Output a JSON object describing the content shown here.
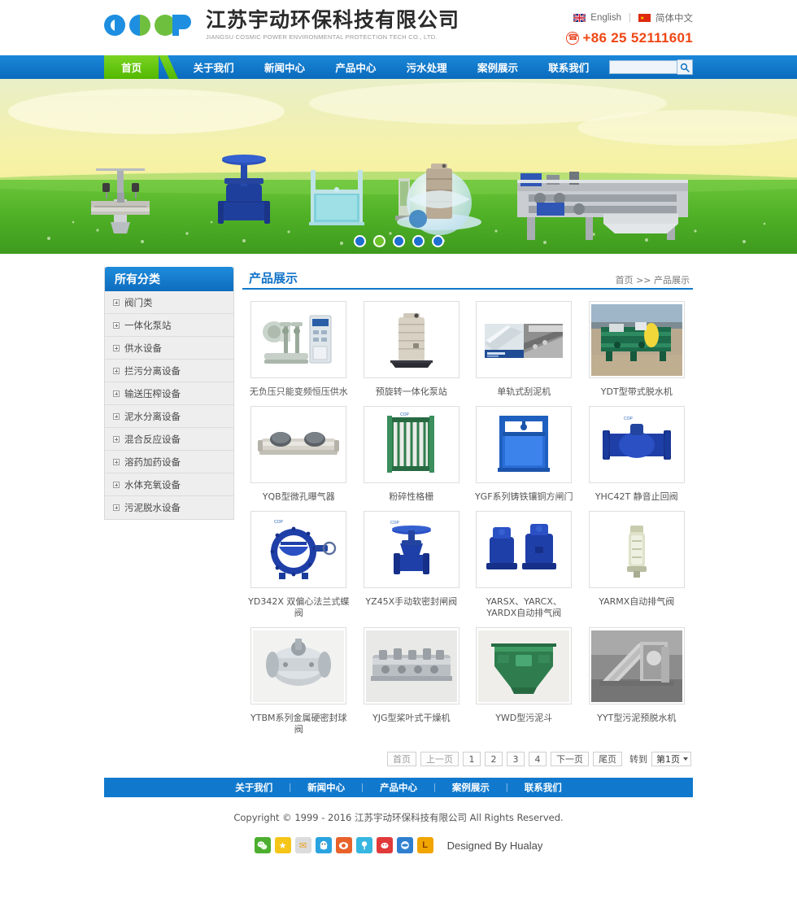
{
  "header": {
    "logo_cn": "江苏宇动环保科技有限公司",
    "logo_en": "JIANGSU COSMIC POWER ENVIRONMENTAL PROTECTION TECH CO., LTD.",
    "logo_letters": "COP",
    "lang_en": "English",
    "lang_cn": "简体中文",
    "lang_sep": "|",
    "phone": "+86 25 52111601",
    "uk_flag_icon": "uk-flag-icon",
    "cn_flag_icon": "cn-flag-icon",
    "phone_icon": "phone-icon"
  },
  "nav": {
    "home": "首页",
    "items": [
      {
        "label": "关于我们"
      },
      {
        "label": "新闻中心"
      },
      {
        "label": "产品中心"
      },
      {
        "label": "污水处理"
      },
      {
        "label": "案例展示"
      },
      {
        "label": "联系我们"
      }
    ],
    "search_value": "",
    "search_placeholder": "",
    "search_icon": "search-icon"
  },
  "banner": {
    "dots": [
      {
        "active": false
      },
      {
        "active": true
      },
      {
        "active": false
      },
      {
        "active": false
      },
      {
        "active": false
      }
    ],
    "sky_color": "#f2efa8",
    "grass_color": "#59b72a"
  },
  "sidebar": {
    "title": "所有分类",
    "items": [
      {
        "label": "阀门类"
      },
      {
        "label": "一体化泵站"
      },
      {
        "label": "供水设备"
      },
      {
        "label": "拦污分离设备"
      },
      {
        "label": "输送压榨设备"
      },
      {
        "label": "泥水分离设备"
      },
      {
        "label": "混合反应设备"
      },
      {
        "label": "溶药加药设备"
      },
      {
        "label": "水体充氧设备"
      },
      {
        "label": "污泥脱水设备"
      }
    ]
  },
  "content": {
    "title": "产品展示",
    "breadcrumb_home": "首页",
    "breadcrumb_sep": ">>",
    "breadcrumb_current": "产品展示",
    "products": [
      {
        "caption": "无负压只能变频恒压供水",
        "art": "pump-station-panel"
      },
      {
        "caption": "预旋转一体化泵站",
        "art": "tank-vessel"
      },
      {
        "caption": "单轨式刮泥机",
        "art": "scraper-photo"
      },
      {
        "caption": "YDT型带式脱水机",
        "art": "belt-press-photo"
      },
      {
        "caption": "YQB型微孔曝气器",
        "art": "aerator-tube"
      },
      {
        "caption": "粉碎性格栅",
        "art": "grinder-grate"
      },
      {
        "caption": "YGF系列铸铁镶铜方闸门",
        "art": "square-gate"
      },
      {
        "caption": "YHC42T 静音止回阀",
        "art": "check-valve"
      },
      {
        "caption": "YD342X 双偏心法兰式蝶阀",
        "art": "butterfly-valve"
      },
      {
        "caption": "YZ45X手动软密封闸阀",
        "art": "gate-valve"
      },
      {
        "caption": "YARSX、YARCX、YARDX自动排气阀",
        "art": "air-release-valves"
      },
      {
        "caption": "YARMX自动排气阀",
        "art": "air-valve-single"
      },
      {
        "caption": "YTBM系列金属硬密封球阀",
        "art": "ball-valve-metal"
      },
      {
        "caption": "YJG型桨叶式干燥机",
        "art": "paddle-dryer"
      },
      {
        "caption": "YWD型污泥斗",
        "art": "sludge-hopper"
      },
      {
        "caption": "YYT型污泥预脱水机",
        "art": "pre-dewatering-machine"
      }
    ]
  },
  "pagination": {
    "first": "首页",
    "prev": "上一页",
    "pages": [
      "1",
      "2",
      "3",
      "4"
    ],
    "next": "下一页",
    "last": "尾页",
    "goto_label": "转到",
    "goto_value": "第1页"
  },
  "footer": {
    "nav": [
      {
        "label": "关于我们"
      },
      {
        "label": "新闻中心"
      },
      {
        "label": "产品中心"
      },
      {
        "label": "案例展示"
      },
      {
        "label": "联系我们"
      }
    ],
    "separator": "|",
    "copyright": "Copyright © 1999 - 2016 江苏宇动环保科技有限公司 All Rights Reserved.",
    "designed_by": "Designed By Hualay",
    "social": [
      {
        "name": "wechat-icon",
        "glyph": "",
        "bg": "#4caf2f"
      },
      {
        "name": "favorite-star-icon",
        "glyph": "★",
        "bg": "#f5c518"
      },
      {
        "name": "email-icon",
        "glyph": "✉",
        "bg": "#dcdcdc"
      },
      {
        "name": "qq-icon",
        "glyph": "",
        "bg": "#2aa3e0"
      },
      {
        "name": "weibo-icon",
        "glyph": "",
        "bg": "#e8622a"
      },
      {
        "name": "qzone-icon",
        "glyph": "",
        "bg": "#36b6e0"
      },
      {
        "name": "renren-icon",
        "glyph": "",
        "bg": "#e03a3a"
      },
      {
        "name": "browser-icon",
        "glyph": "",
        "bg": "#2f7fd0"
      },
      {
        "name": "douban-icon",
        "glyph": "L",
        "bg": "#f0a500"
      }
    ]
  }
}
